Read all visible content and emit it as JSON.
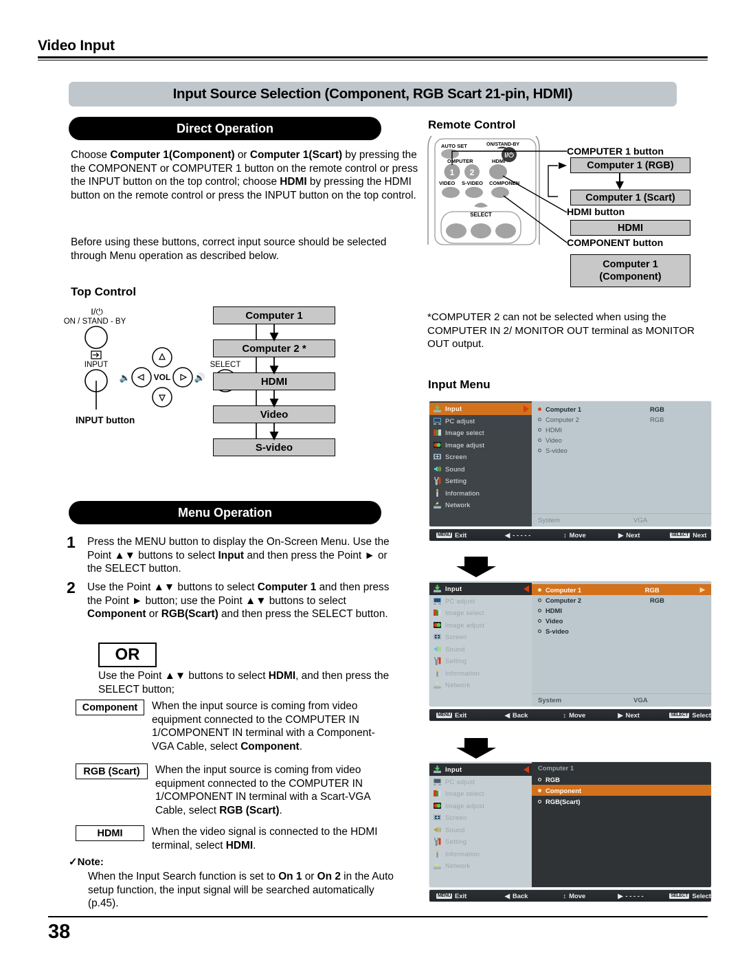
{
  "page": {
    "running_head": "Video Input",
    "page_number": "38",
    "section_title": "Input Source Selection (Component, RGB Scart 21-pin, HDMI)"
  },
  "direct_operation": {
    "banner": "Direct Operation",
    "paragraph1_html": "Choose <b>Computer 1(Component)</b> or <b>Computer 1(Scart)</b> by pressing the the COMPONENT or COMPUTER 1 button on the remote control or press the INPUT button on the top control; choose <b>HDMI</b> by pressing the HDMI button on the remote control or press the INPUT button on the top control.",
    "paragraph2_html": "Before using these buttons, correct input source should be selected through Menu operation as described below."
  },
  "top_control": {
    "heading": "Top Control",
    "power_label_line1": "I/⏻",
    "power_label_line2": "ON / STAND - BY",
    "input_label": "INPUT",
    "vol_label": "VOL",
    "select_label": "SELECT",
    "input_button_callout": "INPUT button",
    "flow": [
      "Computer 1",
      "Computer 2 *",
      "HDMI",
      "Video",
      "S-video"
    ]
  },
  "remote_control": {
    "heading": "Remote Control",
    "keys": {
      "auto_set": "AUTO SET",
      "on_standby": "ON/STAND-BY",
      "computer": "OMPUTER",
      "hdmi": "HDMI",
      "video": "VIDEO",
      "s_video": "S-VIDEO",
      "component": "COMPONEN",
      "select": "SELECT",
      "key1": "1",
      "key2": "2",
      "power_glyph": "I/⏻"
    },
    "callouts": [
      {
        "label": "COMPUTER 1 button"
      },
      {
        "label": "HDMI button"
      },
      {
        "label": "COMPONENT button"
      }
    ],
    "boxes": {
      "computer1_rgb": "Computer 1 (RGB)",
      "computer1_scart": "Computer 1 (Scart)",
      "hdmi": "HDMI",
      "computer1_component_line1": "Computer 1",
      "computer1_component_line2": "(Component)"
    }
  },
  "computer2_note": "*COMPUTER 2 can not be selected when using the COMPUTER IN 2/ MONITOR OUT terminal as MONITOR OUT output.",
  "input_menu": {
    "heading": "Input Menu",
    "sidebar": [
      {
        "label": "Input",
        "icon": "input-icon"
      },
      {
        "label": "PC adjust",
        "icon": "pc-adjust-icon"
      },
      {
        "label": "Image select",
        "icon": "image-select-icon"
      },
      {
        "label": "Image adjust",
        "icon": "image-adjust-icon"
      },
      {
        "label": "Screen",
        "icon": "screen-icon"
      },
      {
        "label": "Sound",
        "icon": "sound-icon"
      },
      {
        "label": "Setting",
        "icon": "setting-icon"
      },
      {
        "label": "Information",
        "icon": "information-icon"
      },
      {
        "label": "Network",
        "icon": "network-icon"
      }
    ],
    "screens": [
      {
        "id": "menu-screen-1",
        "rows": [
          {
            "name": "Computer 1",
            "value": "RGB",
            "selected": true
          },
          {
            "name": "Computer 2",
            "value": "RGB",
            "selected": false
          },
          {
            "name": "HDMI",
            "value": "",
            "selected": false
          },
          {
            "name": "Video",
            "value": "",
            "selected": false
          },
          {
            "name": "S-video",
            "value": "",
            "selected": false
          }
        ],
        "system_label": "System",
        "system_value": "VGA",
        "bar": {
          "exit": "Exit",
          "back": "- - - - -",
          "move": "Move",
          "next": "Next",
          "select": "Next",
          "menu_key": "MENU",
          "select_key": "SELECT"
        }
      },
      {
        "id": "menu-screen-2",
        "rows": [
          {
            "name": "Computer 1",
            "value": "RGB",
            "selected": true
          },
          {
            "name": "Computer 2",
            "value": "RGB",
            "selected": false
          },
          {
            "name": "HDMI",
            "value": "",
            "selected": false
          },
          {
            "name": "Video",
            "value": "",
            "selected": false
          },
          {
            "name": "S-video",
            "value": "",
            "selected": false
          }
        ],
        "system_label": "System",
        "system_value": "VGA",
        "bar": {
          "exit": "Exit",
          "back": "Back",
          "move": "Move",
          "next": "Next",
          "select": "Select",
          "menu_key": "MENU",
          "select_key": "SELECT"
        }
      },
      {
        "id": "menu-screen-3",
        "title": "Computer 1",
        "rows": [
          {
            "name": "RGB",
            "selected": false
          },
          {
            "name": "Component",
            "selected": true
          },
          {
            "name": "RGB(Scart)",
            "selected": false
          }
        ],
        "bar": {
          "exit": "Exit",
          "back": "Back",
          "move": "Move",
          "next": "- - - - -",
          "select": "Select",
          "menu_key": "MENU",
          "select_key": "SELECT"
        }
      }
    ]
  },
  "menu_operation": {
    "banner": "Menu Operation",
    "step1_num": "1",
    "step1_html": "Press the MENU button to display the On-Screen Menu. Use the Point ▲▼ buttons to select <b>Input</b> and then press the Point ► or the SELECT button.",
    "step2_num": "2",
    "step2_html": "Use the Point ▲▼ buttons to select <b>Computer 1</b> and then press the Point ► button; use the Point ▲▼ buttons to select <b>Component</b> or <b>RGB(Scart)</b> and then press the SELECT button.",
    "or_label": "OR",
    "or_text_html": "Use the Point ▲▼ buttons to select <b>HDMI</b>, and then press the SELECT button;",
    "definitions": [
      {
        "tag": "Component",
        "body_html": "When the input source is coming from video equipment connected to the COMPUTER IN 1/COMPONENT IN terminal with a Component-VGA Cable, select <b>Component</b>."
      },
      {
        "tag": "RGB (Scart)",
        "body_html": "When the input source is coming from video equipment connected to the COMPUTER IN 1/COMPONENT IN terminal with a Scart-VGA Cable, select <b>RGB (Scart)</b>."
      },
      {
        "tag": "HDMI",
        "body_html": "When the video signal is connected to the HDMI terminal, select <b>HDMI</b>."
      }
    ],
    "note_heading": "✓Note:",
    "note_body_html": "When the Input Search function is set to <b>On 1</b> or <b>On 2</b> in the Auto setup function, the input signal will be searched automatically (p.45)."
  }
}
